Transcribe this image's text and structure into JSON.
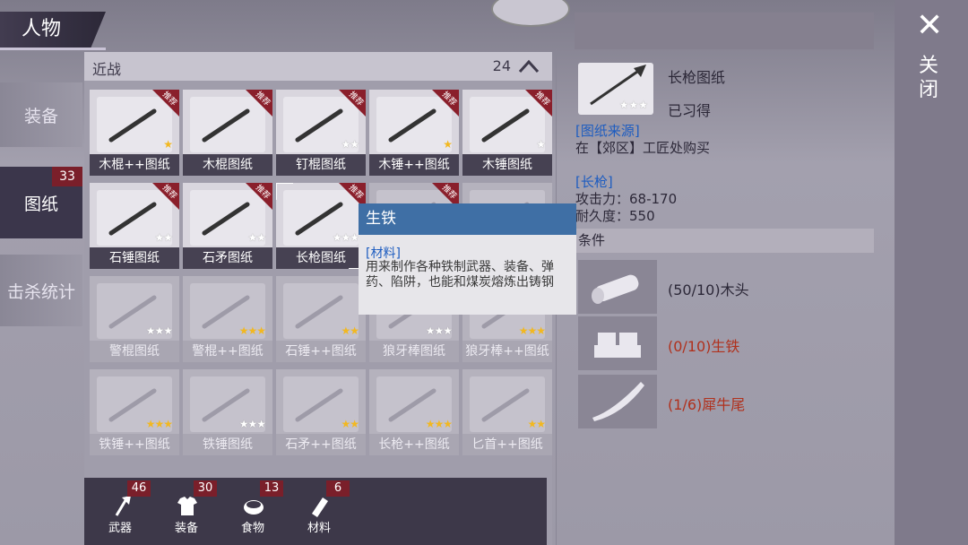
{
  "title": "人物",
  "sidebar": {
    "items": [
      {
        "label": "装备",
        "active": false
      },
      {
        "label": "图纸",
        "active": true,
        "badge": "33"
      },
      {
        "label": "击杀统计",
        "active": false
      }
    ]
  },
  "grid": {
    "header": "近战",
    "count": "24",
    "chevron": "chevron-up-icon",
    "corner_badge": "推荐",
    "cards": [
      {
        "label": "木棍++图纸",
        "stars_filled": 1,
        "stars_total": 1,
        "dim": false,
        "recommended": true,
        "icon": "club-icon"
      },
      {
        "label": "木棍图纸",
        "stars_filled": 0,
        "stars_total": 0,
        "dim": false,
        "recommended": true,
        "icon": "club-icon"
      },
      {
        "label": "钉棍图纸",
        "stars_filled": 0,
        "stars_total": 2,
        "dim": false,
        "recommended": true,
        "icon": "spiked-club-icon"
      },
      {
        "label": "木锤++图纸",
        "stars_filled": 1,
        "stars_total": 1,
        "dim": false,
        "recommended": true,
        "icon": "hammer-icon"
      },
      {
        "label": "木锤图纸",
        "stars_filled": 0,
        "stars_total": 1,
        "dim": false,
        "recommended": true,
        "icon": "hammer-icon"
      },
      {
        "label": "石锤图纸",
        "stars_filled": 0,
        "stars_total": 2,
        "dim": false,
        "recommended": true,
        "icon": "stone-hammer-icon"
      },
      {
        "label": "石矛图纸",
        "stars_filled": 0,
        "stars_total": 2,
        "dim": false,
        "recommended": true,
        "icon": "spear-icon"
      },
      {
        "label": "长枪图纸",
        "stars_filled": 0,
        "stars_total": 3,
        "dim": false,
        "recommended": true,
        "selected": true,
        "icon": "spear-icon"
      },
      {
        "label": "",
        "stars_filled": 0,
        "stars_total": 0,
        "dim": true,
        "recommended": true,
        "icon": "blueprint-icon"
      },
      {
        "label": "",
        "stars_filled": 0,
        "stars_total": 0,
        "dim": true,
        "recommended": false,
        "icon": "blueprint-icon"
      },
      {
        "label": "警棍图纸",
        "stars_filled": 0,
        "stars_total": 3,
        "dim": true,
        "recommended": false,
        "icon": "baton-icon"
      },
      {
        "label": "警棍++图纸",
        "stars_filled": 3,
        "stars_total": 3,
        "dim": true,
        "recommended": false,
        "icon": "baton-icon"
      },
      {
        "label": "石锤++图纸",
        "stars_filled": 2,
        "stars_total": 2,
        "dim": true,
        "recommended": false,
        "icon": "stone-hammer-icon"
      },
      {
        "label": "狼牙棒图纸",
        "stars_filled": 0,
        "stars_total": 3,
        "dim": true,
        "recommended": false,
        "icon": "mace-icon"
      },
      {
        "label": "狼牙棒++图纸",
        "stars_filled": 3,
        "stars_total": 3,
        "dim": true,
        "recommended": false,
        "icon": "mace-icon"
      },
      {
        "label": "铁锤++图纸",
        "stars_filled": 3,
        "stars_total": 3,
        "dim": true,
        "recommended": false,
        "icon": "iron-hammer-icon"
      },
      {
        "label": "铁锤图纸",
        "stars_filled": 0,
        "stars_total": 3,
        "dim": true,
        "recommended": false,
        "icon": "iron-hammer-icon"
      },
      {
        "label": "石矛++图纸",
        "stars_filled": 2,
        "stars_total": 2,
        "dim": true,
        "recommended": false,
        "icon": "spear-icon"
      },
      {
        "label": "长枪++图纸",
        "stars_filled": 3,
        "stars_total": 3,
        "dim": true,
        "recommended": false,
        "icon": "spear-icon"
      },
      {
        "label": "匕首++图纸",
        "stars_filled": 2,
        "stars_total": 2,
        "dim": true,
        "recommended": false,
        "icon": "dagger-icon"
      }
    ]
  },
  "tooltip": {
    "title": "生铁",
    "category": "[材料]",
    "description": "用来制作各种铁制武器、装备、弹药、陷阱，也能和煤炭熔炼出铸钢"
  },
  "bottom_tabs": [
    {
      "label": "武器",
      "badge": "46",
      "icon": "axe-icon"
    },
    {
      "label": "装备",
      "badge": "30",
      "icon": "shirt-icon"
    },
    {
      "label": "食物",
      "badge": "13",
      "icon": "food-icon"
    },
    {
      "label": "材料",
      "badge": "6",
      "icon": "material-icon"
    }
  ],
  "detail": {
    "name": "长枪图纸",
    "status": "已习得",
    "stars_total": 3,
    "source_label": "[图纸来源]",
    "source_text": "在【郊区】工匠处购买",
    "weapon_label": "[长枪]",
    "attack": "攻击力：68-170",
    "durability": "耐久度：550",
    "conditions_label": "条件",
    "materials": [
      {
        "text": "(50/10)木头",
        "sufficient": true,
        "icon": "wood-log-icon"
      },
      {
        "text": "(0/10)生铁",
        "sufficient": false,
        "icon": "pig-iron-icon"
      },
      {
        "text": "(1/6)犀牛尾",
        "sufficient": false,
        "icon": "rhino-tail-icon"
      }
    ]
  },
  "close": {
    "label": "关闭",
    "icon": "close-icon"
  },
  "colors": {
    "sufficient": "#2c2838",
    "insufficient": "#b0311d",
    "star_filled": "#f2b820",
    "link_blue": "#1d5cc0"
  }
}
